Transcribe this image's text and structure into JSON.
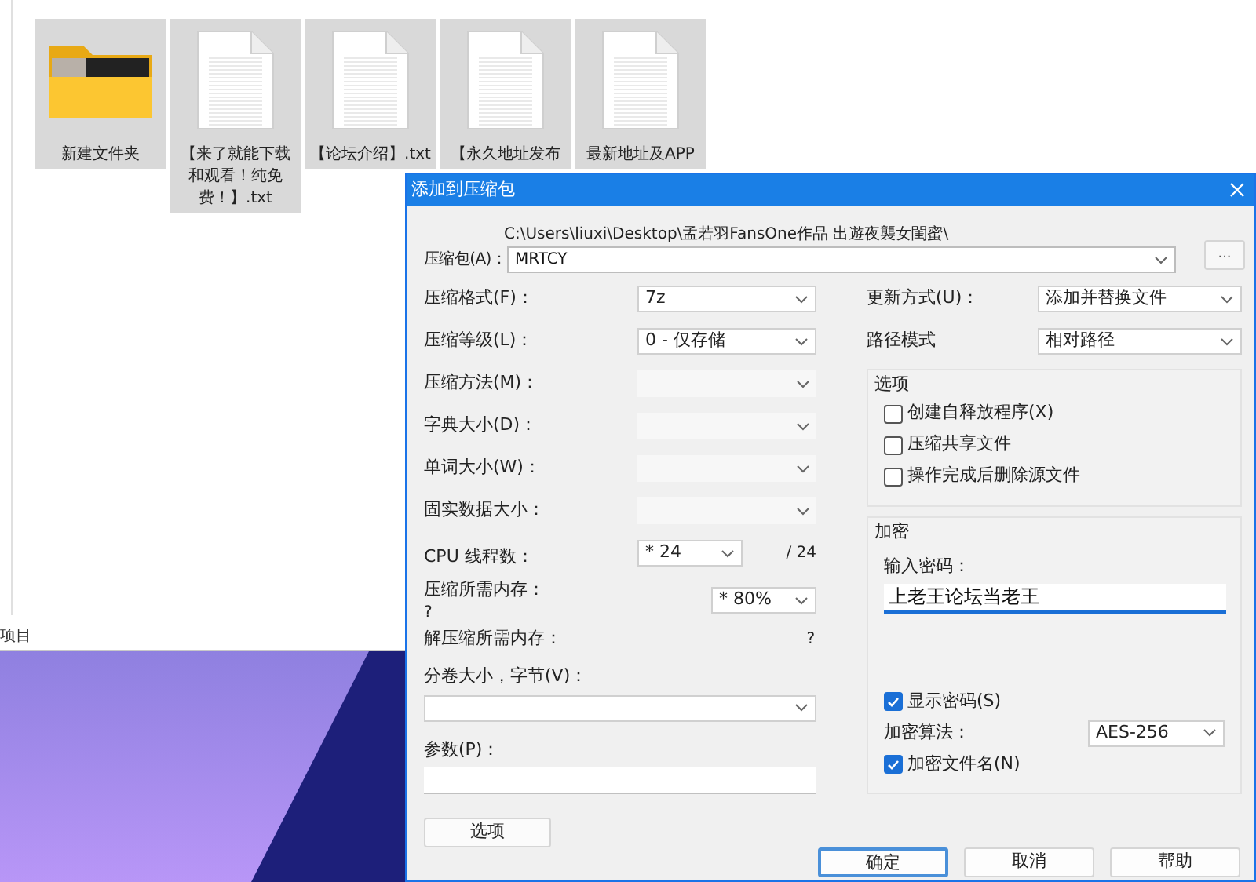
{
  "explorer": {
    "files": [
      {
        "name": "新建文件夹",
        "kind": "folder",
        "selected": true
      },
      {
        "name": "【来了就能下载和观看！纯免费！】.txt",
        "kind": "text",
        "selected": true
      },
      {
        "name": "【论坛介绍】.txt",
        "kind": "text",
        "selected": true
      },
      {
        "name": "【永久地址发布",
        "kind": "text",
        "selected": true
      },
      {
        "name": "最新地址及APP",
        "kind": "text",
        "selected": true
      }
    ],
    "status": "项目"
  },
  "dialog": {
    "title": "添加到压缩包",
    "archive": {
      "label": "压缩包(A)：",
      "path": "C:\\Users\\liuxi\\Desktop\\孟若羽FansOne作品 出遊夜襲女閨蜜\\",
      "name": "MRTCY",
      "browse": "..."
    },
    "left_fields": [
      {
        "label": "压缩格式(F)：",
        "kind": "select",
        "value": "7z",
        "disabled": false
      },
      {
        "label": "压缩等级(L)：",
        "kind": "select",
        "value": "0 - 仅存储",
        "disabled": false
      },
      {
        "label": "压缩方法(M)：",
        "kind": "select",
        "disabled": true
      },
      {
        "label": "字典大小(D)：",
        "kind": "select",
        "disabled": true
      },
      {
        "label": "单词大小(W)：",
        "kind": "select",
        "disabled": true
      },
      {
        "label": "固实数据大小：",
        "kind": "select",
        "disabled": true
      },
      {
        "label": "CPU 线程数：",
        "kind": "threads",
        "value": "* 24",
        "suffix": "/ 24",
        "disabled": false
      },
      {
        "label": "压缩所需内存：",
        "kind": "memory",
        "note": "?",
        "value": "* 80%",
        "disabled": false
      },
      {
        "label": "解压缩所需内存：",
        "kind": "info",
        "value": "?"
      }
    ],
    "volume": {
      "label": "分卷大小，字节(V)："
    },
    "params": {
      "label": "参数(P)："
    },
    "options_button": "选项",
    "update": {
      "label": "更新方式(U)：",
      "value": "添加并替换文件"
    },
    "path_mode": {
      "label": "路径模式",
      "value": "相对路径"
    },
    "options": {
      "title": "选项",
      "items": [
        {
          "label": "创建自释放程序(X)",
          "checked": false
        },
        {
          "label": "压缩共享文件",
          "checked": false
        },
        {
          "label": "操作完成后删除源文件",
          "checked": false
        }
      ]
    },
    "encryption": {
      "title": "加密",
      "password_label": "输入密码：",
      "password": "上老王论坛当老王",
      "show_password": {
        "label": "显示密码(S)",
        "checked": true
      },
      "method_label": "加密算法：",
      "method": "AES-256",
      "encrypt_names": {
        "label": "加密文件名(N)",
        "checked": true
      }
    },
    "buttons": [
      {
        "label": "确定",
        "focused": true
      },
      {
        "label": "取消",
        "focused": false
      },
      {
        "label": "帮助",
        "focused": false
      }
    ]
  }
}
